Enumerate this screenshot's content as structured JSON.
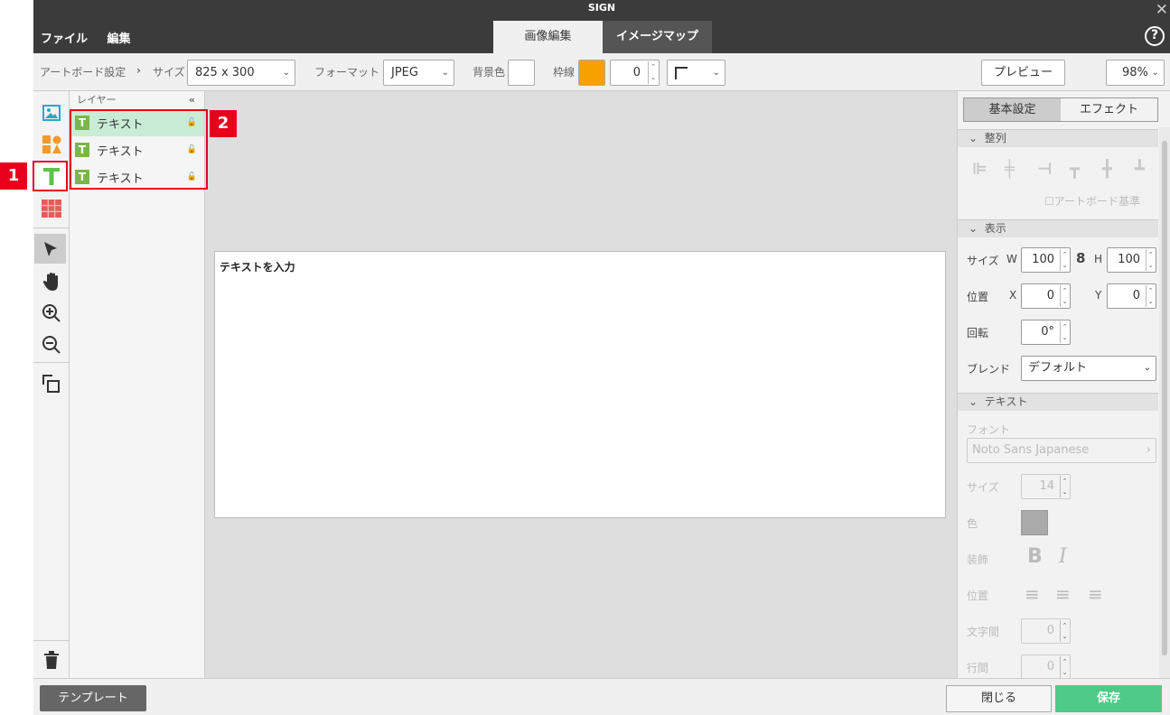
{
  "window": {
    "title": "SIGN",
    "close_glyph": "✕"
  },
  "menu": [
    "ファイル",
    "編集"
  ],
  "tabs": [
    {
      "label": "画像編集",
      "active": true
    },
    {
      "label": "イメージマップ",
      "active": false
    }
  ],
  "help_glyph": "?",
  "toolbar": {
    "breadcrumb": "アートボード設定",
    "breadcrumb_sep": "›",
    "size_label": "サイズ",
    "size_value": "825 x 300",
    "format_label": "フォーマット",
    "format_value": "JPEG",
    "bg_label": "背景色",
    "bg_color": "#ffffff",
    "border_label": "枠線",
    "border_color": "#f7a000",
    "border_width": "0",
    "preview_label": "プレビュー",
    "zoom_value": "98%"
  },
  "left_tools": [
    "image-icon",
    "shapes-icon",
    "text-icon",
    "table-icon",
    "select-arrow-icon",
    "hand-icon",
    "zoom-in-icon",
    "zoom-out-icon",
    "layer-order-icon",
    "trash-icon"
  ],
  "layers": {
    "header": "レイヤー",
    "collapse": "«",
    "items": [
      {
        "label": "テキスト",
        "icon": "T",
        "selected": true
      },
      {
        "label": "テキスト",
        "icon": "T",
        "selected": false
      },
      {
        "label": "テキスト",
        "icon": "T",
        "selected": false
      }
    ]
  },
  "canvas": {
    "text": "テキストを入力"
  },
  "panel": {
    "tabs": [
      "基本設定",
      "エフェクト"
    ],
    "align_section": "整列",
    "artboard_ref": "アートボード基準",
    "display_section": "表示",
    "size_label": "サイズ",
    "w_label": "W",
    "w_value": "100",
    "h_label": "H",
    "h_value": "100",
    "pos_label": "位置",
    "x_label": "X",
    "x_value": "0",
    "y_label": "Y",
    "y_value": "0",
    "rotation_label": "回転",
    "rotation_value": "0°",
    "blend_label": "ブレンド",
    "blend_value": "デフォルト",
    "text_section": "テキスト",
    "font_label": "フォント",
    "font_value": "Noto Sans Japanese",
    "font_size_label": "サイズ",
    "font_size_value": "14",
    "color_label": "色",
    "deco_label": "装飾",
    "text_pos_label": "位置",
    "letter_spacing_label": "文字間",
    "letter_spacing_value": "0",
    "line_spacing_label": "行間",
    "line_spacing_value": "0"
  },
  "bottom": {
    "template_label": "テンプレート",
    "close_label": "閉じる",
    "save_label": "保存"
  },
  "callouts": [
    "1",
    "2"
  ],
  "colors": {
    "accent_green": "#4ecb86",
    "callout_red": "#e8001c",
    "titlebar": "#3b3b3b"
  }
}
